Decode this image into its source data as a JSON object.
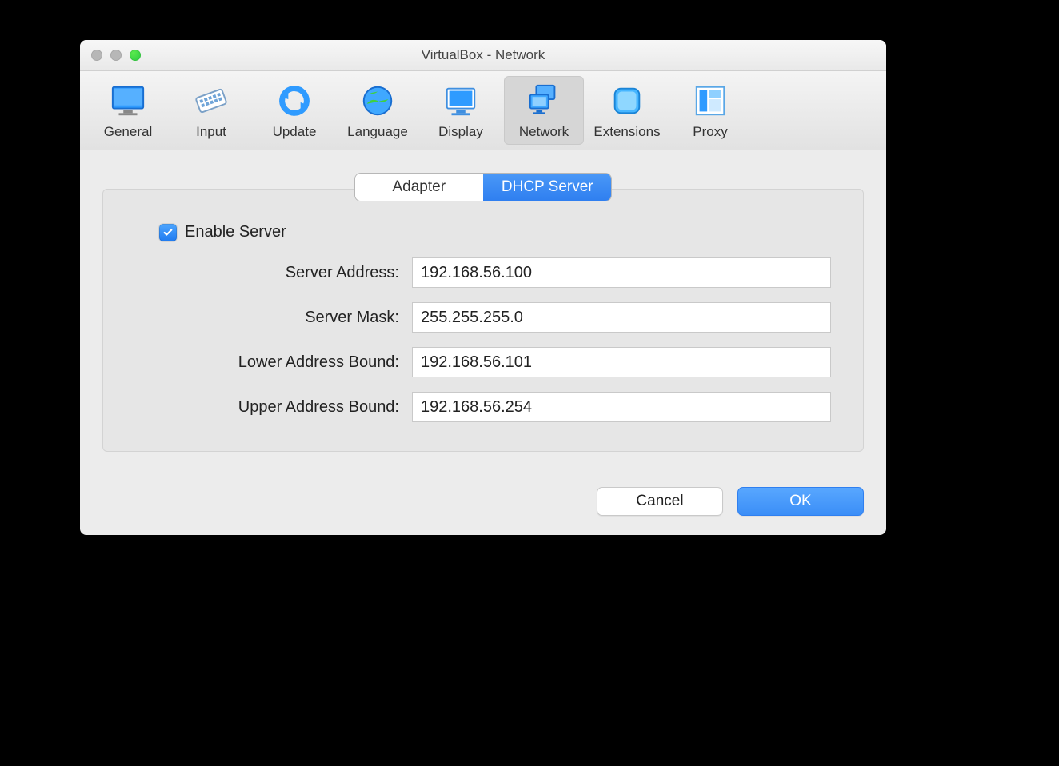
{
  "window": {
    "title": "VirtualBox - Network"
  },
  "toolbar": {
    "items": [
      {
        "label": "General",
        "selected": false
      },
      {
        "label": "Input",
        "selected": false
      },
      {
        "label": "Update",
        "selected": false
      },
      {
        "label": "Language",
        "selected": false
      },
      {
        "label": "Display",
        "selected": false
      },
      {
        "label": "Network",
        "selected": true
      },
      {
        "label": "Extensions",
        "selected": false
      },
      {
        "label": "Proxy",
        "selected": false
      }
    ]
  },
  "segmented": {
    "items": [
      {
        "label": "Adapter",
        "active": false
      },
      {
        "label": "DHCP Server",
        "active": true
      }
    ]
  },
  "form": {
    "enable_server_label": "Enable Server",
    "enable_server_checked": true,
    "labels": {
      "server_address": "Server Address:",
      "server_mask": "Server Mask:",
      "lower_bound": "Lower Address Bound:",
      "upper_bound": "Upper Address Bound:"
    },
    "values": {
      "server_address": "192.168.56.100",
      "server_mask": "255.255.255.0",
      "lower_bound": "192.168.56.101",
      "upper_bound": "192.168.56.254"
    }
  },
  "buttons": {
    "cancel": "Cancel",
    "ok": "OK"
  }
}
